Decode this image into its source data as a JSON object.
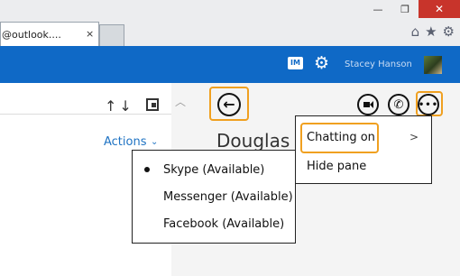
{
  "browser": {
    "tab_title": "@outlook....",
    "tab_close": "×",
    "window_controls": {
      "minimize": "—",
      "restore": "❐",
      "close": "✕"
    },
    "toolbar_icons": [
      "home-icon",
      "star-icon",
      "gear-icon"
    ]
  },
  "header": {
    "chat_icon_label": "IM",
    "user_name": "Stacey Hanson",
    "bg_color": "#0f69c6"
  },
  "mail_list": {
    "actions_label": "Actions",
    "actions_chevron": "⌄"
  },
  "chat_pane": {
    "contact_name": "Douglas P",
    "highlight_color": "#f0a020"
  },
  "more_menu": {
    "items": [
      {
        "label": "Chatting on",
        "has_submenu": true
      },
      {
        "label": "Hide pane",
        "has_submenu": false
      }
    ],
    "submenu_chevron": ">"
  },
  "chatting_submenu": {
    "items": [
      {
        "label": "Skype (Available)",
        "selected": true
      },
      {
        "label": "Messenger (Available)",
        "selected": false
      },
      {
        "label": "Facebook (Available)",
        "selected": false
      }
    ]
  }
}
